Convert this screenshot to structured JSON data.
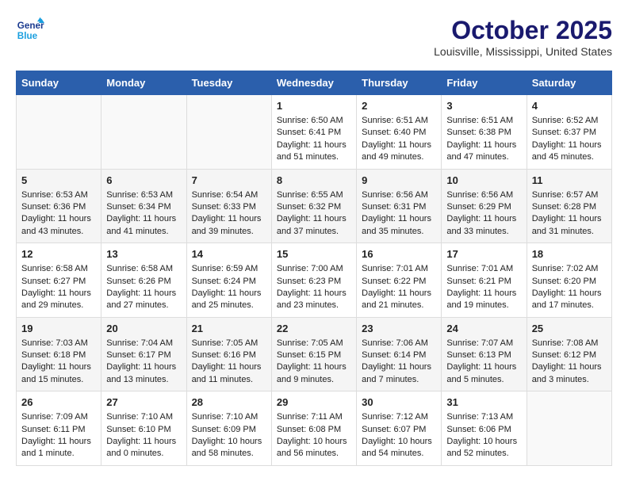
{
  "header": {
    "logo_line1": "General",
    "logo_line2": "Blue",
    "month": "October 2025",
    "location": "Louisville, Mississippi, United States"
  },
  "weekdays": [
    "Sunday",
    "Monday",
    "Tuesday",
    "Wednesday",
    "Thursday",
    "Friday",
    "Saturday"
  ],
  "weeks": [
    [
      {
        "day": "",
        "sunrise": "",
        "sunset": "",
        "daylight": ""
      },
      {
        "day": "",
        "sunrise": "",
        "sunset": "",
        "daylight": ""
      },
      {
        "day": "",
        "sunrise": "",
        "sunset": "",
        "daylight": ""
      },
      {
        "day": "1",
        "sunrise": "Sunrise: 6:50 AM",
        "sunset": "Sunset: 6:41 PM",
        "daylight": "Daylight: 11 hours and 51 minutes."
      },
      {
        "day": "2",
        "sunrise": "Sunrise: 6:51 AM",
        "sunset": "Sunset: 6:40 PM",
        "daylight": "Daylight: 11 hours and 49 minutes."
      },
      {
        "day": "3",
        "sunrise": "Sunrise: 6:51 AM",
        "sunset": "Sunset: 6:38 PM",
        "daylight": "Daylight: 11 hours and 47 minutes."
      },
      {
        "day": "4",
        "sunrise": "Sunrise: 6:52 AM",
        "sunset": "Sunset: 6:37 PM",
        "daylight": "Daylight: 11 hours and 45 minutes."
      }
    ],
    [
      {
        "day": "5",
        "sunrise": "Sunrise: 6:53 AM",
        "sunset": "Sunset: 6:36 PM",
        "daylight": "Daylight: 11 hours and 43 minutes."
      },
      {
        "day": "6",
        "sunrise": "Sunrise: 6:53 AM",
        "sunset": "Sunset: 6:34 PM",
        "daylight": "Daylight: 11 hours and 41 minutes."
      },
      {
        "day": "7",
        "sunrise": "Sunrise: 6:54 AM",
        "sunset": "Sunset: 6:33 PM",
        "daylight": "Daylight: 11 hours and 39 minutes."
      },
      {
        "day": "8",
        "sunrise": "Sunrise: 6:55 AM",
        "sunset": "Sunset: 6:32 PM",
        "daylight": "Daylight: 11 hours and 37 minutes."
      },
      {
        "day": "9",
        "sunrise": "Sunrise: 6:56 AM",
        "sunset": "Sunset: 6:31 PM",
        "daylight": "Daylight: 11 hours and 35 minutes."
      },
      {
        "day": "10",
        "sunrise": "Sunrise: 6:56 AM",
        "sunset": "Sunset: 6:29 PM",
        "daylight": "Daylight: 11 hours and 33 minutes."
      },
      {
        "day": "11",
        "sunrise": "Sunrise: 6:57 AM",
        "sunset": "Sunset: 6:28 PM",
        "daylight": "Daylight: 11 hours and 31 minutes."
      }
    ],
    [
      {
        "day": "12",
        "sunrise": "Sunrise: 6:58 AM",
        "sunset": "Sunset: 6:27 PM",
        "daylight": "Daylight: 11 hours and 29 minutes."
      },
      {
        "day": "13",
        "sunrise": "Sunrise: 6:58 AM",
        "sunset": "Sunset: 6:26 PM",
        "daylight": "Daylight: 11 hours and 27 minutes."
      },
      {
        "day": "14",
        "sunrise": "Sunrise: 6:59 AM",
        "sunset": "Sunset: 6:24 PM",
        "daylight": "Daylight: 11 hours and 25 minutes."
      },
      {
        "day": "15",
        "sunrise": "Sunrise: 7:00 AM",
        "sunset": "Sunset: 6:23 PM",
        "daylight": "Daylight: 11 hours and 23 minutes."
      },
      {
        "day": "16",
        "sunrise": "Sunrise: 7:01 AM",
        "sunset": "Sunset: 6:22 PM",
        "daylight": "Daylight: 11 hours and 21 minutes."
      },
      {
        "day": "17",
        "sunrise": "Sunrise: 7:01 AM",
        "sunset": "Sunset: 6:21 PM",
        "daylight": "Daylight: 11 hours and 19 minutes."
      },
      {
        "day": "18",
        "sunrise": "Sunrise: 7:02 AM",
        "sunset": "Sunset: 6:20 PM",
        "daylight": "Daylight: 11 hours and 17 minutes."
      }
    ],
    [
      {
        "day": "19",
        "sunrise": "Sunrise: 7:03 AM",
        "sunset": "Sunset: 6:18 PM",
        "daylight": "Daylight: 11 hours and 15 minutes."
      },
      {
        "day": "20",
        "sunrise": "Sunrise: 7:04 AM",
        "sunset": "Sunset: 6:17 PM",
        "daylight": "Daylight: 11 hours and 13 minutes."
      },
      {
        "day": "21",
        "sunrise": "Sunrise: 7:05 AM",
        "sunset": "Sunset: 6:16 PM",
        "daylight": "Daylight: 11 hours and 11 minutes."
      },
      {
        "day": "22",
        "sunrise": "Sunrise: 7:05 AM",
        "sunset": "Sunset: 6:15 PM",
        "daylight": "Daylight: 11 hours and 9 minutes."
      },
      {
        "day": "23",
        "sunrise": "Sunrise: 7:06 AM",
        "sunset": "Sunset: 6:14 PM",
        "daylight": "Daylight: 11 hours and 7 minutes."
      },
      {
        "day": "24",
        "sunrise": "Sunrise: 7:07 AM",
        "sunset": "Sunset: 6:13 PM",
        "daylight": "Daylight: 11 hours and 5 minutes."
      },
      {
        "day": "25",
        "sunrise": "Sunrise: 7:08 AM",
        "sunset": "Sunset: 6:12 PM",
        "daylight": "Daylight: 11 hours and 3 minutes."
      }
    ],
    [
      {
        "day": "26",
        "sunrise": "Sunrise: 7:09 AM",
        "sunset": "Sunset: 6:11 PM",
        "daylight": "Daylight: 11 hours and 1 minute."
      },
      {
        "day": "27",
        "sunrise": "Sunrise: 7:10 AM",
        "sunset": "Sunset: 6:10 PM",
        "daylight": "Daylight: 11 hours and 0 minutes."
      },
      {
        "day": "28",
        "sunrise": "Sunrise: 7:10 AM",
        "sunset": "Sunset: 6:09 PM",
        "daylight": "Daylight: 10 hours and 58 minutes."
      },
      {
        "day": "29",
        "sunrise": "Sunrise: 7:11 AM",
        "sunset": "Sunset: 6:08 PM",
        "daylight": "Daylight: 10 hours and 56 minutes."
      },
      {
        "day": "30",
        "sunrise": "Sunrise: 7:12 AM",
        "sunset": "Sunset: 6:07 PM",
        "daylight": "Daylight: 10 hours and 54 minutes."
      },
      {
        "day": "31",
        "sunrise": "Sunrise: 7:13 AM",
        "sunset": "Sunset: 6:06 PM",
        "daylight": "Daylight: 10 hours and 52 minutes."
      },
      {
        "day": "",
        "sunrise": "",
        "sunset": "",
        "daylight": ""
      }
    ]
  ]
}
